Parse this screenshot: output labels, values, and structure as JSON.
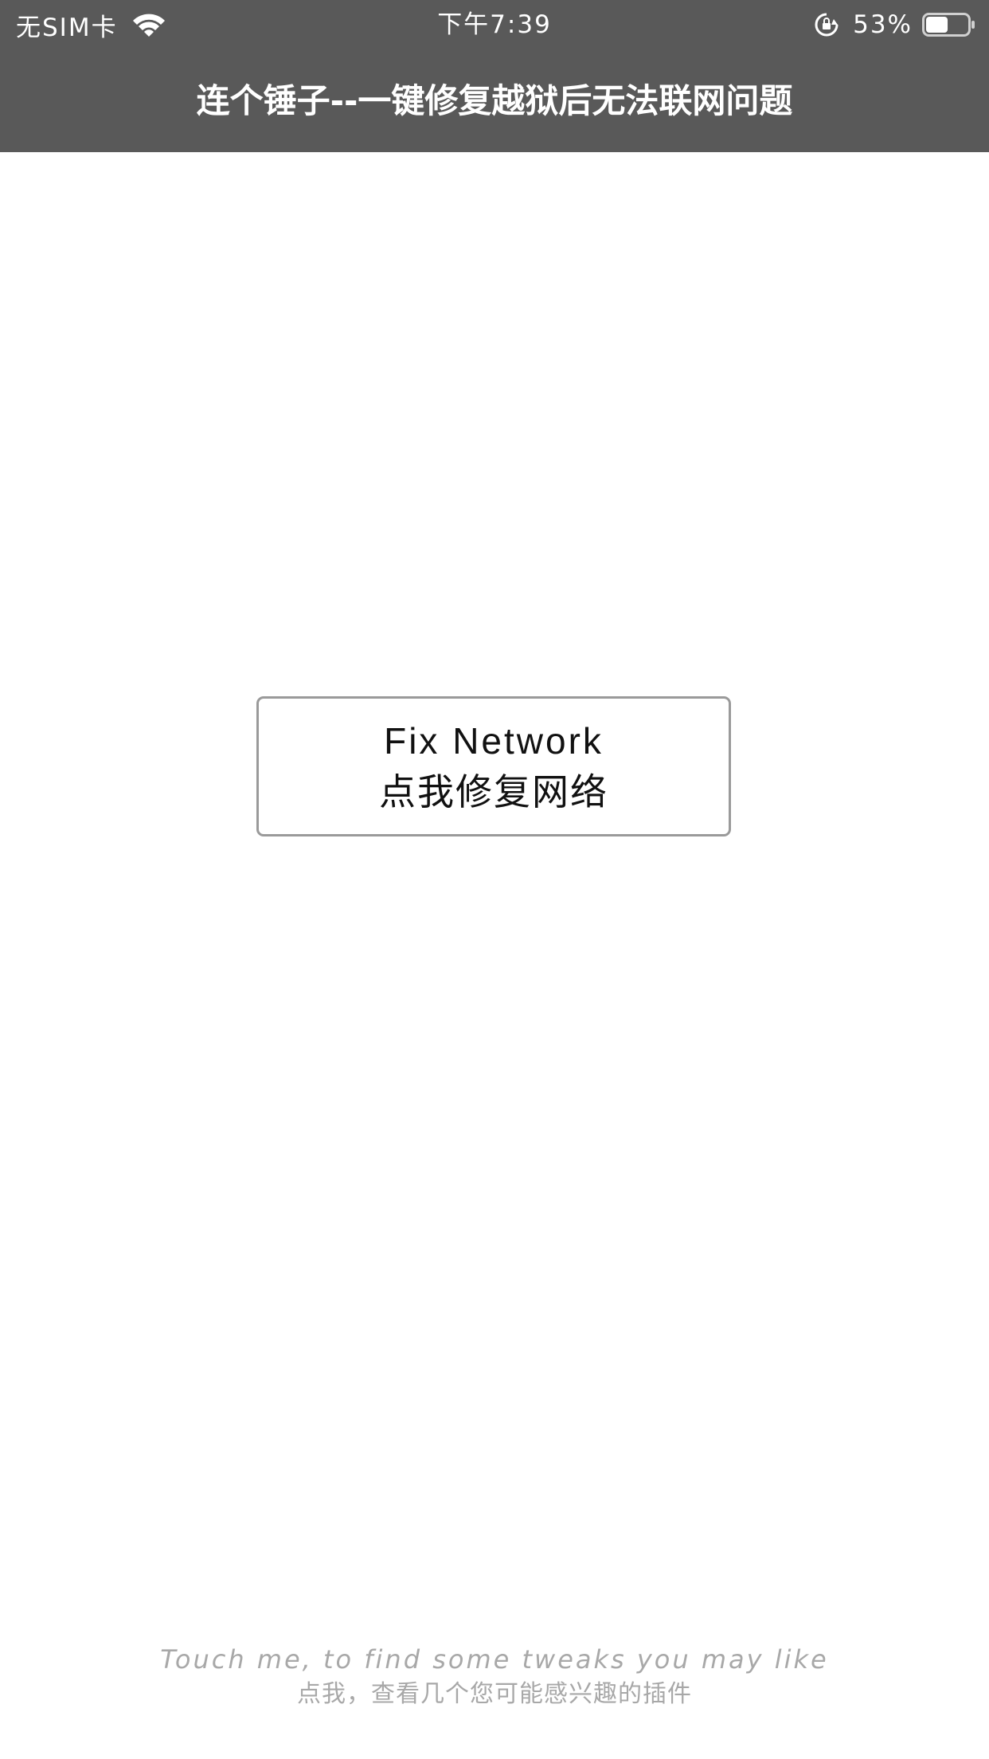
{
  "status_bar": {
    "carrier": "无SIM卡",
    "time": "下午7:39",
    "battery_percent": "53%",
    "battery_level": 0.53,
    "icons": [
      "wifi-icon",
      "rotation-lock-icon",
      "battery-icon"
    ]
  },
  "navbar": {
    "title": "连个锤子--一键修复越狱后无法联网问题"
  },
  "fix_button": {
    "label_en": "Fix Network",
    "label_zh": "点我修复网络"
  },
  "footer": {
    "line_en": "Touch me, to find some tweaks you may like",
    "line_zh": "点我，查看几个您可能感兴趣的插件"
  },
  "colors": {
    "navbar_background": "#595959",
    "page_background": "#ffffff",
    "button_border": "#9a9a9a",
    "footer_text": "#a8a8a8"
  }
}
